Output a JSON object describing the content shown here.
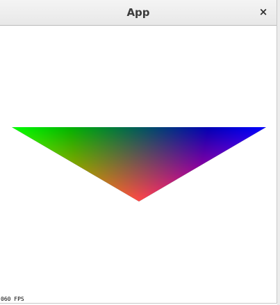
{
  "window": {
    "title": "App",
    "close_glyph": "×"
  },
  "scene": {
    "shape": "triangle",
    "vertex_colors": {
      "left": "#00ff00",
      "right": "#0000ff",
      "bottom": "#ff0000"
    },
    "background": "#ffffff"
  },
  "overlay": {
    "fps_text": "060 FPS"
  }
}
